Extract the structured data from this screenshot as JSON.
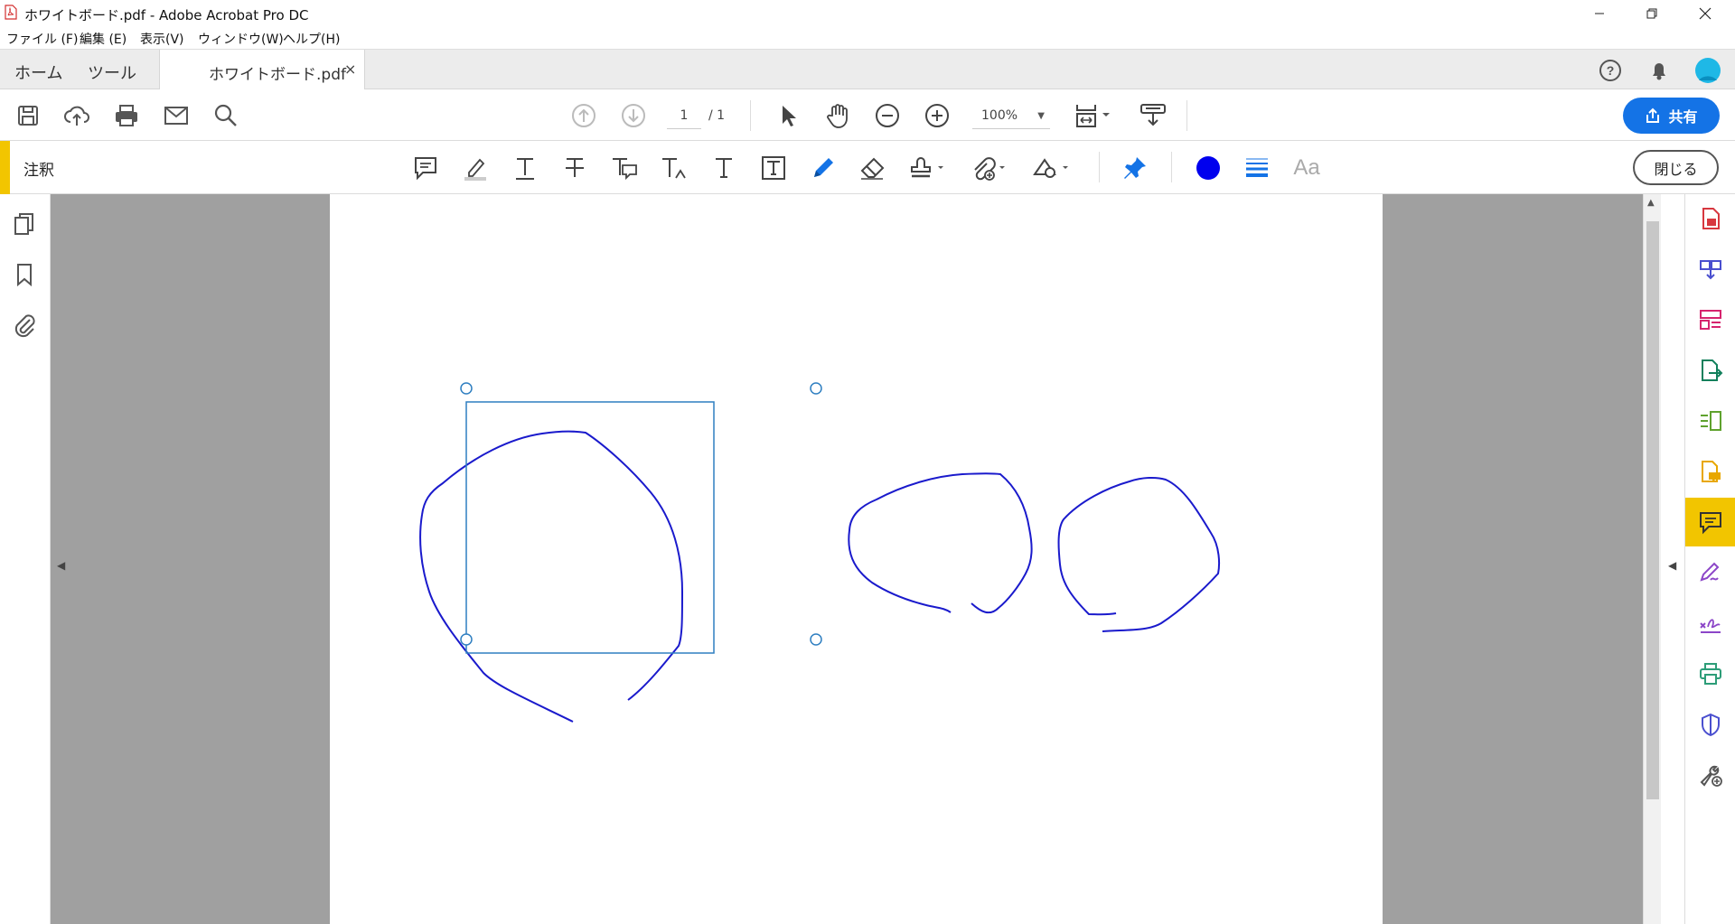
{
  "window": {
    "title": "ホワイトボード.pdf - Adobe Acrobat Pro DC",
    "minimize_icon": "minimize-icon",
    "restore_icon": "restore-icon",
    "close_icon": "close-icon"
  },
  "menu": [
    "ファイル (F)",
    "編集 (E)",
    "表示(V)",
    "ウィンドウ(W)",
    "ヘルプ(H)"
  ],
  "tabs": {
    "home": "ホーム",
    "tools": "ツール",
    "document": "ホワイトボード.pdf",
    "close_symbol": "×"
  },
  "toolbar": {
    "page_current": "1",
    "page_total": "/ 1",
    "zoom": "100%",
    "share_label": "共有",
    "accent_color": "#1473e6"
  },
  "comment_bar": {
    "label": "注釈",
    "close_label": "閉じる",
    "text_size_label": "Aa",
    "ink_color": "#0000ee",
    "accent_color": "#f2c500"
  },
  "page": {
    "ink_color": "#1a1acc",
    "selection_color": "#2f7fc1"
  }
}
